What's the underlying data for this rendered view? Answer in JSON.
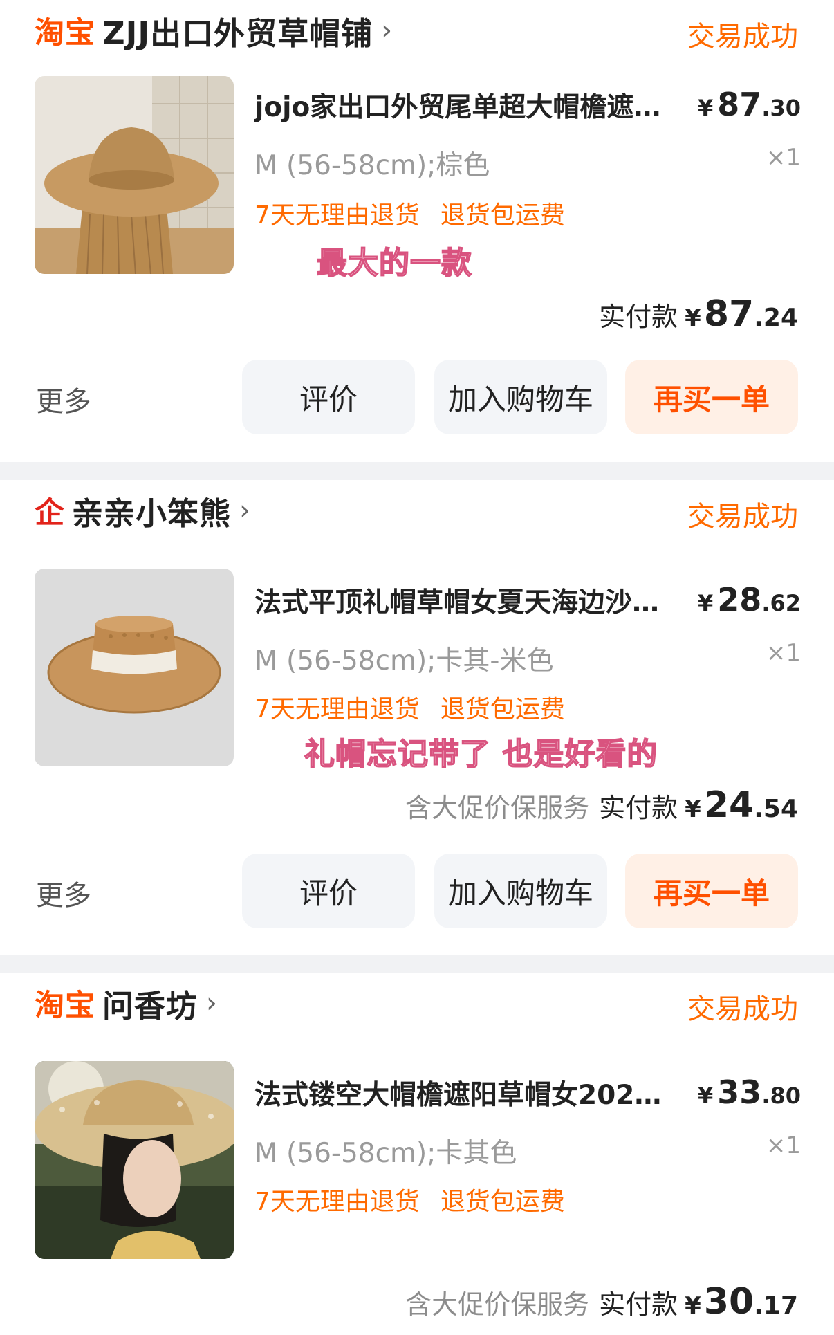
{
  "orders": [
    {
      "shop_logo": "淘宝",
      "shop_name": "ZJJ出口外贸草帽铺",
      "status": "交易成功",
      "title": "jojo家出口外贸尾单超大帽檐遮…",
      "price": {
        "currency": "¥",
        "int": "87",
        "dec": ".30"
      },
      "sku": "M (56-58cm);棕色",
      "qty": "×1",
      "tags": [
        "7天无理由退货",
        "退货包运费"
      ],
      "note": "最大的一款",
      "pay": {
        "service": "",
        "label": "实付款",
        "currency": "¥",
        "int": "87",
        "dec": ".24"
      },
      "more": "更多",
      "buttons": [
        "评价",
        "加入购物车",
        "再买一单"
      ]
    },
    {
      "shop_logo": "企",
      "shop_name": "亲亲小笨熊",
      "status": "交易成功",
      "title": "法式平顶礼帽草帽女夏天海边沙…",
      "price": {
        "currency": "¥",
        "int": "28",
        "dec": ".62"
      },
      "sku": "M (56-58cm);卡其-米色",
      "qty": "×1",
      "tags": [
        "7天无理由退货",
        "退货包运费"
      ],
      "note": "礼帽忘记带了 也是好看的",
      "pay": {
        "service": "含大促价保服务",
        "label": "实付款",
        "currency": "¥",
        "int": "24",
        "dec": ".54"
      },
      "more": "更多",
      "buttons": [
        "评价",
        "加入购物车",
        "再买一单"
      ]
    },
    {
      "shop_logo": "淘宝",
      "shop_name": "问香坊",
      "status": "交易成功",
      "title": "法式镂空大帽檐遮阳草帽女202…",
      "price": {
        "currency": "¥",
        "int": "33",
        "dec": ".80"
      },
      "sku": "M (56-58cm);卡其色",
      "qty": "×1",
      "tags": [
        "7天无理由退货",
        "退货包运费"
      ],
      "pay": {
        "service": "含大促价保服务",
        "label": "实付款",
        "currency": "¥",
        "int": "30",
        "dec": ".17"
      }
    }
  ],
  "colors": {
    "accent": "#ff5000",
    "status": "#ff6a00",
    "note_fill": "#fbd6e2",
    "note_stroke": "#d9537f",
    "separator": "#f1f2f4"
  },
  "icons": [
    "chevron-right-icon"
  ]
}
